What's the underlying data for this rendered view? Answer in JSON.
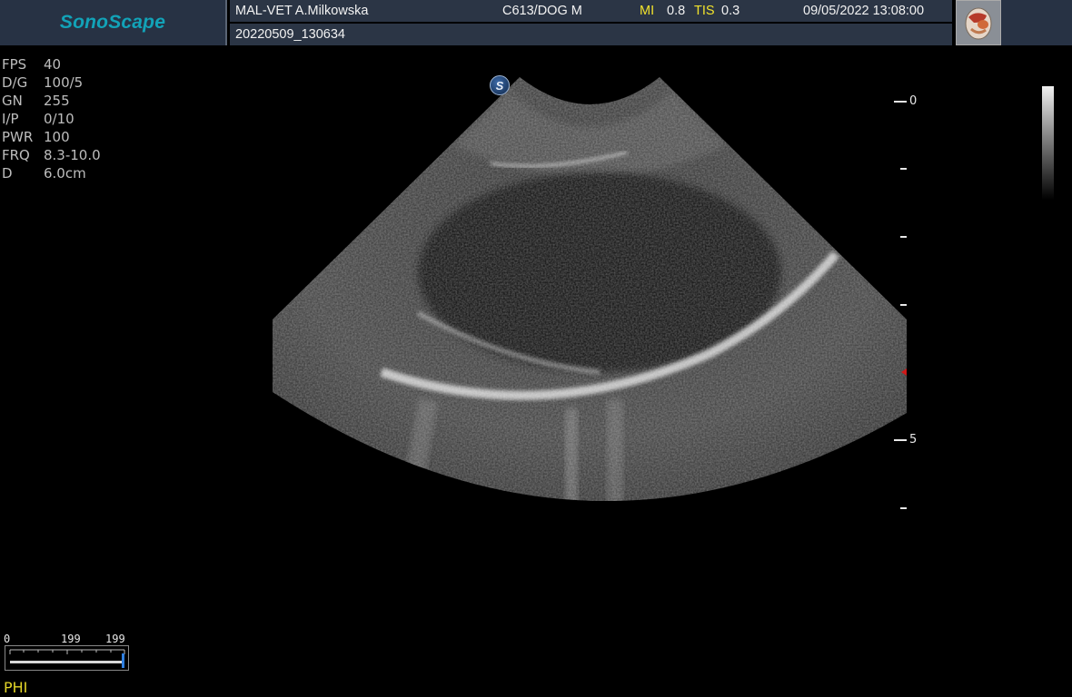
{
  "header": {
    "logo": "SonoScape",
    "operator": "MAL-VET A.Milkowska",
    "probe_preset": "C613/DOG M",
    "mi_label": "MI",
    "mi_value": "0.8",
    "tis_label": "TIS",
    "tis_value": "0.3",
    "datetime": "09/05/2022 13:08:00",
    "study_id": "20220509_130634",
    "organ_icon": "abdomen-organ-icon"
  },
  "params": [
    {
      "key": "FPS",
      "value": "40"
    },
    {
      "key": "D/G",
      "value": "100/5"
    },
    {
      "key": "GN",
      "value": "255"
    },
    {
      "key": "I/P",
      "value": "0/10"
    },
    {
      "key": "PWR",
      "value": "100"
    },
    {
      "key": "FRQ",
      "value": "8.3-10.0"
    },
    {
      "key": "D",
      "value": "6.0cm"
    }
  ],
  "depth_scale": {
    "label_0": "0",
    "label_5": "5"
  },
  "badge": "S",
  "slider": {
    "min_label": "0",
    "mid_label": "199",
    "max_label": "199"
  },
  "mode_label": "PHI",
  "colors": {
    "header_bg": "#2b3545",
    "logo_color": "#12a3b8",
    "yellow": "#f1e22c",
    "focus_marker": "#d01818"
  }
}
